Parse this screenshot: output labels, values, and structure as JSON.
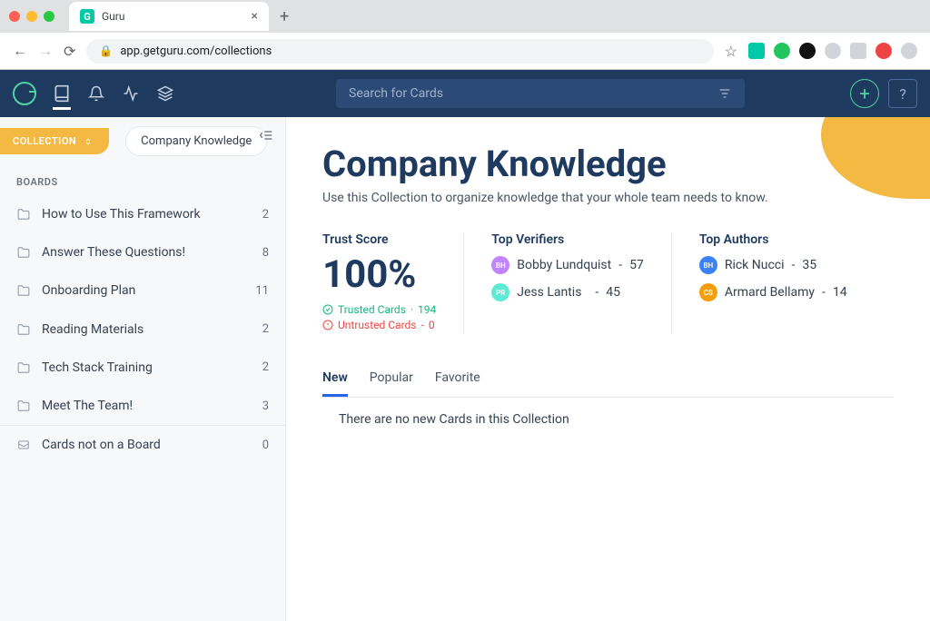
{
  "browser": {
    "tab_title": "Guru",
    "url": "app.getguru.com/collections"
  },
  "header": {
    "search_placeholder": "Search for Cards"
  },
  "sidebar": {
    "collection_label": "COLLECTION",
    "collection_name": "Company Knowledge",
    "boards_label": "BOARDS",
    "boards": [
      {
        "name": "How to Use This Framework",
        "count": 2
      },
      {
        "name": "Answer These Questions!",
        "count": 8
      },
      {
        "name": "Onboarding Plan",
        "count": 11
      },
      {
        "name": "Reading Materials",
        "count": 2
      },
      {
        "name": "Tech Stack Training",
        "count": 2
      },
      {
        "name": "Meet The Team!",
        "count": 3
      }
    ],
    "not_on_board": {
      "name": "Cards not on a Board",
      "count": 0
    }
  },
  "main": {
    "title": "Company Knowledge",
    "subtitle": "Use this Collection to organize knowledge that your whole team needs to know.",
    "trust": {
      "label": "Trust Score",
      "percent": "100%",
      "trusted_label": "Trusted Cards",
      "trusted_count": 194,
      "untrusted_label": "Untrusted Cards",
      "untrusted_count": 0
    },
    "verifiers": {
      "label": "Top Verifiers",
      "people": [
        {
          "initials": "BH",
          "name": "Bobby Lundquist",
          "count": 57,
          "color": "#c084fc"
        },
        {
          "initials": "PR",
          "name": "Jess Lantis",
          "count": 45,
          "color": "#5eead4"
        }
      ]
    },
    "authors": {
      "label": "Top Authors",
      "people": [
        {
          "initials": "BH",
          "name": "Rick Nucci",
          "count": 35,
          "color": "#3b82f6"
        },
        {
          "initials": "CS",
          "name": "Armard Bellamy",
          "count": 14,
          "color": "#f59e0b"
        }
      ]
    },
    "tabs": [
      "New",
      "Popular",
      "Favorite"
    ],
    "empty_message": "There are no new Cards in this Collection"
  }
}
